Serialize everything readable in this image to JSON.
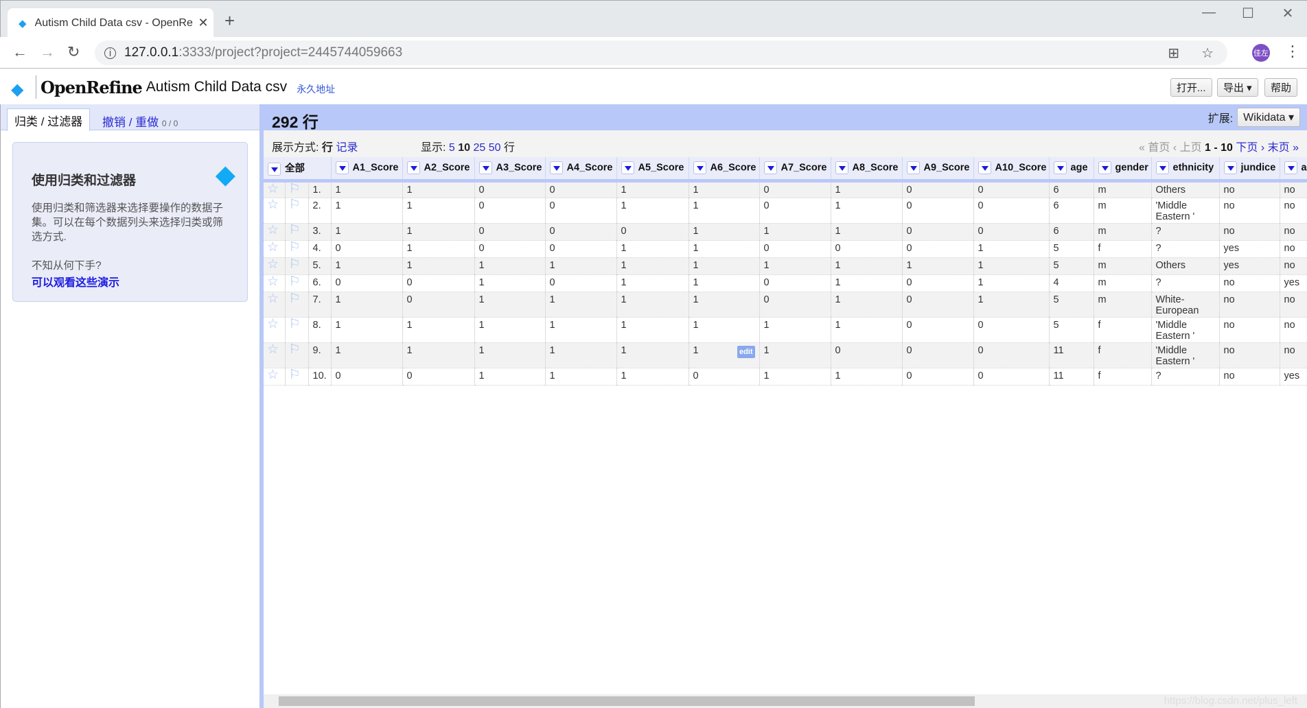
{
  "browser": {
    "tab_title": "Autism Child Data csv - OpenRefine",
    "url_host": "127.0.0.1",
    "url_rest": ":3333/project?project=2445744059663",
    "avatar_text": "佳左"
  },
  "header": {
    "brand": "OpenRefine",
    "project": "Autism Child Data csv",
    "permalink": "永久地址",
    "buttons": {
      "open": "打开...",
      "export": "导出 ▾",
      "help": "帮助"
    }
  },
  "left": {
    "tab_facets": "归类 / 过滤器",
    "tab_undo": "撤销 / 重做",
    "undo_count": "0 / 0",
    "help_title": "使用归类和过滤器",
    "help_text": "使用归类和筛选器来选择要操作的数据子集。可以在每个数据列头来选择归类或筛选方式.",
    "help_q": "不知从何下手?",
    "help_link": "可以观看这些演示"
  },
  "main": {
    "row_count": "292 行",
    "ext_label": "扩展:",
    "ext_button": "Wikidata ▾",
    "view_label": "展示方式:",
    "view_rows": "行",
    "view_records": "记录",
    "show_label": "显示:",
    "show_5": "5",
    "show_10": "10",
    "show_25": "25",
    "show_50": "50",
    "show_unit": "行",
    "pg_first": "« 首页",
    "pg_prev": "‹ 上页",
    "pg_range": "1 - 10",
    "pg_next": "下页 ›",
    "pg_last": "末页 »",
    "all_label": "全部",
    "edit_label": "edit",
    "watermark": "https://blog.csdn.net/plus_left"
  },
  "columns": [
    "A1_Score",
    "A2_Score",
    "A3_Score",
    "A4_Score",
    "A5_Score",
    "A6_Score",
    "A7_Score",
    "A8_Score",
    "A9_Score",
    "A10_Score",
    "age",
    "gender",
    "ethnicity",
    "jundice",
    "a"
  ],
  "rows": [
    [
      "1.",
      "1",
      "1",
      "0",
      "0",
      "1",
      "1",
      "0",
      "1",
      "0",
      "0",
      "6",
      "m",
      "Others",
      "no",
      "no"
    ],
    [
      "2.",
      "1",
      "1",
      "0",
      "0",
      "1",
      "1",
      "0",
      "1",
      "0",
      "0",
      "6",
      "m",
      "'Middle Eastern '",
      "no",
      "no"
    ],
    [
      "3.",
      "1",
      "1",
      "0",
      "0",
      "0",
      "1",
      "1",
      "1",
      "0",
      "0",
      "6",
      "m",
      "?",
      "no",
      "no"
    ],
    [
      "4.",
      "0",
      "1",
      "0",
      "0",
      "1",
      "1",
      "0",
      "0",
      "0",
      "1",
      "5",
      "f",
      "?",
      "yes",
      "no"
    ],
    [
      "5.",
      "1",
      "1",
      "1",
      "1",
      "1",
      "1",
      "1",
      "1",
      "1",
      "1",
      "5",
      "m",
      "Others",
      "yes",
      "no"
    ],
    [
      "6.",
      "0",
      "0",
      "1",
      "0",
      "1",
      "1",
      "0",
      "1",
      "0",
      "1",
      "4",
      "m",
      "?",
      "no",
      "yes"
    ],
    [
      "7.",
      "1",
      "0",
      "1",
      "1",
      "1",
      "1",
      "0",
      "1",
      "0",
      "1",
      "5",
      "m",
      "White-European",
      "no",
      "no"
    ],
    [
      "8.",
      "1",
      "1",
      "1",
      "1",
      "1",
      "1",
      "1",
      "1",
      "0",
      "0",
      "5",
      "f",
      "'Middle Eastern '",
      "no",
      "no"
    ],
    [
      "9.",
      "1",
      "1",
      "1",
      "1",
      "1",
      "1",
      "1",
      "0",
      "0",
      "0",
      "11",
      "f",
      "'Middle Eastern '",
      "no",
      "no"
    ],
    [
      "10.",
      "0",
      "0",
      "1",
      "1",
      "1",
      "0",
      "1",
      "1",
      "0",
      "0",
      "11",
      "f",
      "?",
      "no",
      "yes"
    ]
  ]
}
